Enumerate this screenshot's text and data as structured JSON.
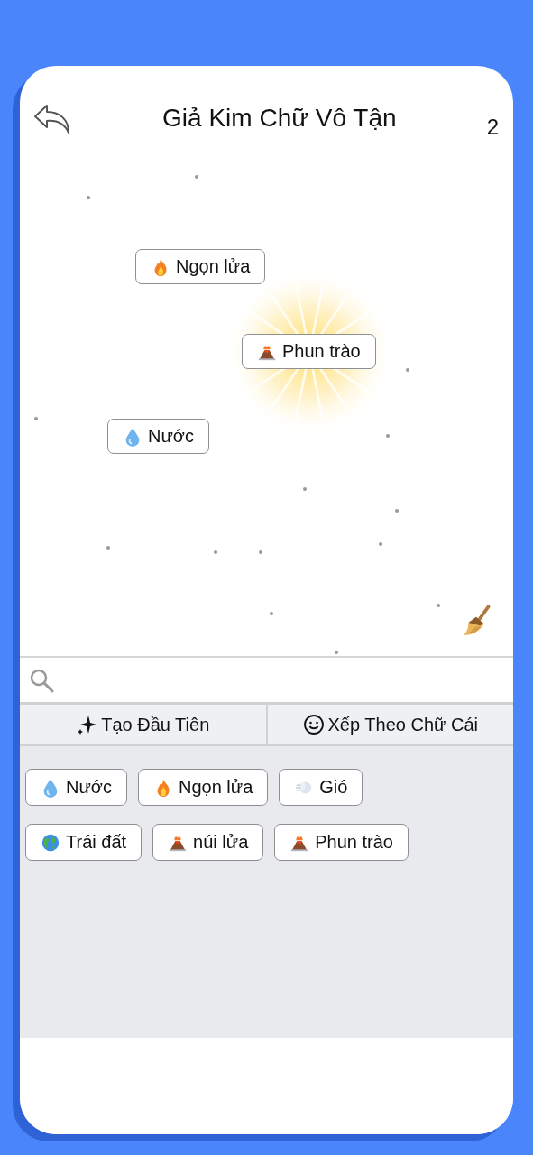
{
  "header": {
    "title": "Giả Kim Chữ Vô Tận",
    "count": "2"
  },
  "canvas": {
    "items": [
      {
        "label": "Ngọn lửa",
        "kind": "fire",
        "highlighted": false
      },
      {
        "label": "Phun trào",
        "kind": "volcano",
        "highlighted": true
      },
      {
        "label": "Nước",
        "kind": "water",
        "highlighted": false
      }
    ]
  },
  "sort_buttons": [
    {
      "label": "Tạo Đầu Tiên",
      "kind": "sparkle"
    },
    {
      "label": "Xếp Theo Chữ Cái",
      "kind": "smiley"
    }
  ],
  "inventory": [
    {
      "label": "Nước",
      "kind": "water"
    },
    {
      "label": "Ngọn lửa",
      "kind": "fire"
    },
    {
      "label": "Gió",
      "kind": "wind"
    },
    {
      "label": "Trái đất",
      "kind": "earth"
    },
    {
      "label": "núi lửa",
      "kind": "volcano"
    },
    {
      "label": "Phun trào",
      "kind": "volcano"
    }
  ]
}
